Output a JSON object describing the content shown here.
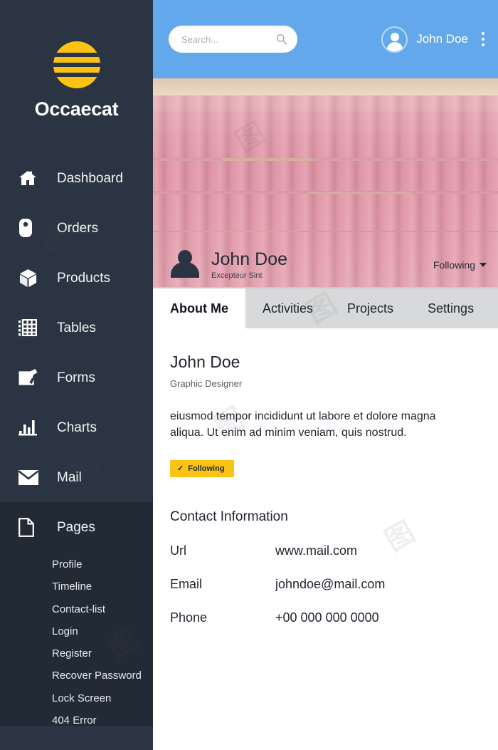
{
  "brand": {
    "name": "Occaecat",
    "logo_icon": "striped-circle-logo",
    "logo_color": "#fcc314"
  },
  "sidebar": {
    "background_color": "#2b3442",
    "items": [
      {
        "label": "Dashboard",
        "icon": "home-icon",
        "active": false
      },
      {
        "label": "Orders",
        "icon": "tag-icon",
        "active": false
      },
      {
        "label": "Products",
        "icon": "box-icon",
        "active": false
      },
      {
        "label": "Tables",
        "icon": "grid-icon",
        "active": false
      },
      {
        "label": "Forms",
        "icon": "edit-note-icon",
        "active": false
      },
      {
        "label": "Charts",
        "icon": "bar-chart-icon",
        "active": false
      },
      {
        "label": "Mail",
        "icon": "envelope-icon",
        "active": false
      },
      {
        "label": "Pages",
        "icon": "document-icon",
        "active": true
      }
    ],
    "submenu": [
      {
        "label": "Profile"
      },
      {
        "label": "Timeline"
      },
      {
        "label": "Contact-list"
      },
      {
        "label": "Login"
      },
      {
        "label": "Register"
      },
      {
        "label": "Recover Password"
      },
      {
        "label": "Lock Screen"
      },
      {
        "label": "404 Error"
      }
    ]
  },
  "topbar": {
    "background_color": "#64a8ec",
    "search": {
      "placeholder": "Search...",
      "value": "",
      "icon": "search-icon"
    },
    "user": {
      "name": "John Doe",
      "avatar_icon": "user-avatar-icon"
    },
    "menu_icon": "kebab-menu-icon"
  },
  "banner": {
    "image_description": "rows of pink theater seats",
    "name": "John Doe",
    "subtitle": "Excepteur Sint",
    "avatar_icon": "user-silhouette-icon",
    "following_label": "Following",
    "dropdown_icon": "chevron-down-icon"
  },
  "tabs": [
    {
      "label": "About Me",
      "active": true
    },
    {
      "label": "Activities",
      "active": false
    },
    {
      "label": "Projects",
      "active": false
    },
    {
      "label": "Settings",
      "active": false
    }
  ],
  "profile": {
    "name": "John Doe",
    "role": "Graphic Designer",
    "bio": "eiusmod tempor incididunt ut labore et dolore magna aliqua. Ut enim ad minim veniam, quis nostrud.",
    "follow_button": {
      "label": "Following",
      "icon": "check-icon",
      "glyph": "✓",
      "color": "#fcc314"
    }
  },
  "contact": {
    "title": "Contact Information",
    "rows": [
      {
        "label": "Url",
        "value": "www.mail.com"
      },
      {
        "label": "Email",
        "value": "johndoe@mail.com"
      },
      {
        "label": "Phone",
        "value": "+00 000 000 0000"
      }
    ]
  },
  "watermark": {
    "text": "图"
  }
}
